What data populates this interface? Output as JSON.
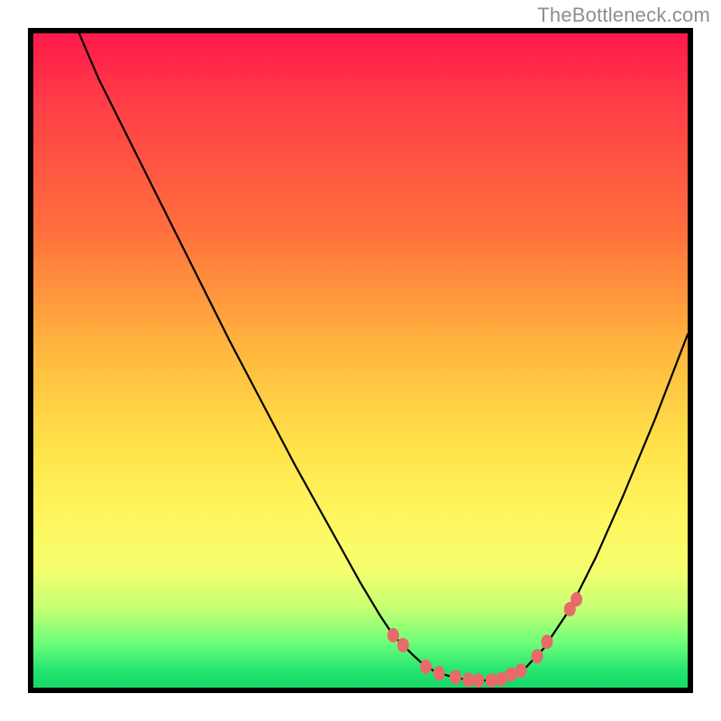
{
  "attribution": "TheBottleneck.com",
  "colors": {
    "frame": "#000000",
    "curve": "#000000",
    "marker_fill": "#e86a6a",
    "marker_stroke": "#c94f4f",
    "gradient_top": "#ff1a4b",
    "gradient_bottom": "#17d867"
  },
  "chart_data": {
    "type": "line",
    "title": "",
    "xlabel": "",
    "ylabel": "",
    "xlim": [
      0,
      100
    ],
    "ylim": [
      0,
      100
    ],
    "series": [
      {
        "name": "bottleneck-curve",
        "x": [
          7,
          10,
          15,
          20,
          25,
          30,
          35,
          40,
          45,
          50,
          53,
          55,
          58,
          60,
          62,
          65,
          68,
          70,
          72,
          75,
          78,
          82,
          86,
          90,
          95,
          100
        ],
        "y": [
          100,
          93,
          83,
          73,
          63,
          53,
          43.5,
          34,
          25,
          16,
          11,
          8,
          5,
          3.2,
          2.2,
          1.4,
          1.1,
          1.1,
          1.4,
          2.8,
          6,
          12,
          20,
          29,
          41,
          54
        ]
      }
    ],
    "markers": {
      "name": "highlight-points",
      "x": [
        55,
        56.5,
        60,
        62,
        64.5,
        66.5,
        68,
        70,
        71.5,
        73,
        74.5,
        77,
        78.5,
        82,
        83
      ],
      "y": [
        8,
        6.5,
        3.2,
        2.2,
        1.6,
        1.2,
        1.1,
        1.1,
        1.3,
        2,
        2.6,
        4.8,
        7,
        12,
        13.5
      ]
    }
  }
}
